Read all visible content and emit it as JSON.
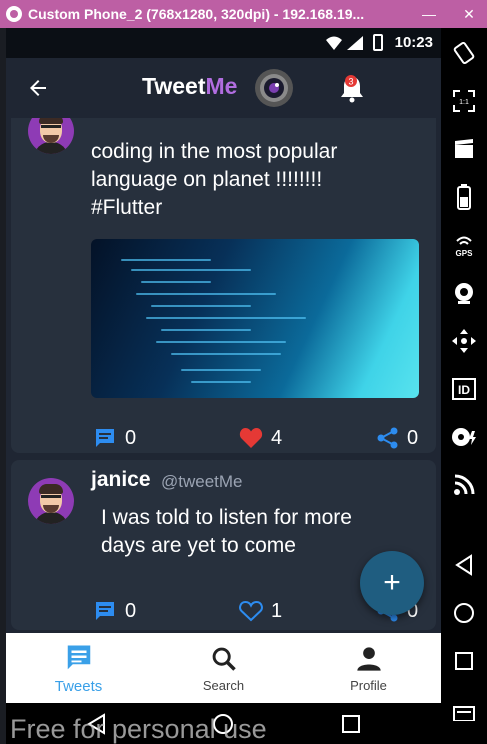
{
  "window": {
    "title": "Custom Phone_2 (768x1280, 320dpi) - 192.168.19...",
    "minimize": "—",
    "close": "✕"
  },
  "status_bar": {
    "time": "10:23"
  },
  "app_bar": {
    "brand_tweet": "Tweet",
    "brand_me": "Me",
    "notification_count": "3"
  },
  "tweets": [
    {
      "text_lines": [
        "coding in the most popular",
        "language on planet !!!!!!!!",
        "#Flutter"
      ],
      "comments": "0",
      "likes": "4",
      "shares": "0",
      "liked": true
    },
    {
      "name": "janice",
      "handle": "@tweetMe",
      "text_lines": [
        "I was told to listen for more",
        "days are yet to come"
      ],
      "comments": "0",
      "likes": "1",
      "shares": "0",
      "liked": false
    }
  ],
  "fab": {
    "label": "+"
  },
  "bottom_nav": [
    {
      "label": "Tweets",
      "active": true
    },
    {
      "label": "Search",
      "active": false
    },
    {
      "label": "Profile",
      "active": false
    }
  ],
  "watermark": "Free for personal use",
  "colors": {
    "accent": "#3aa0e8",
    "brand_me": "#b16de0",
    "like_red": "#e53935",
    "card": "#27303d",
    "background": "#1f2633"
  }
}
